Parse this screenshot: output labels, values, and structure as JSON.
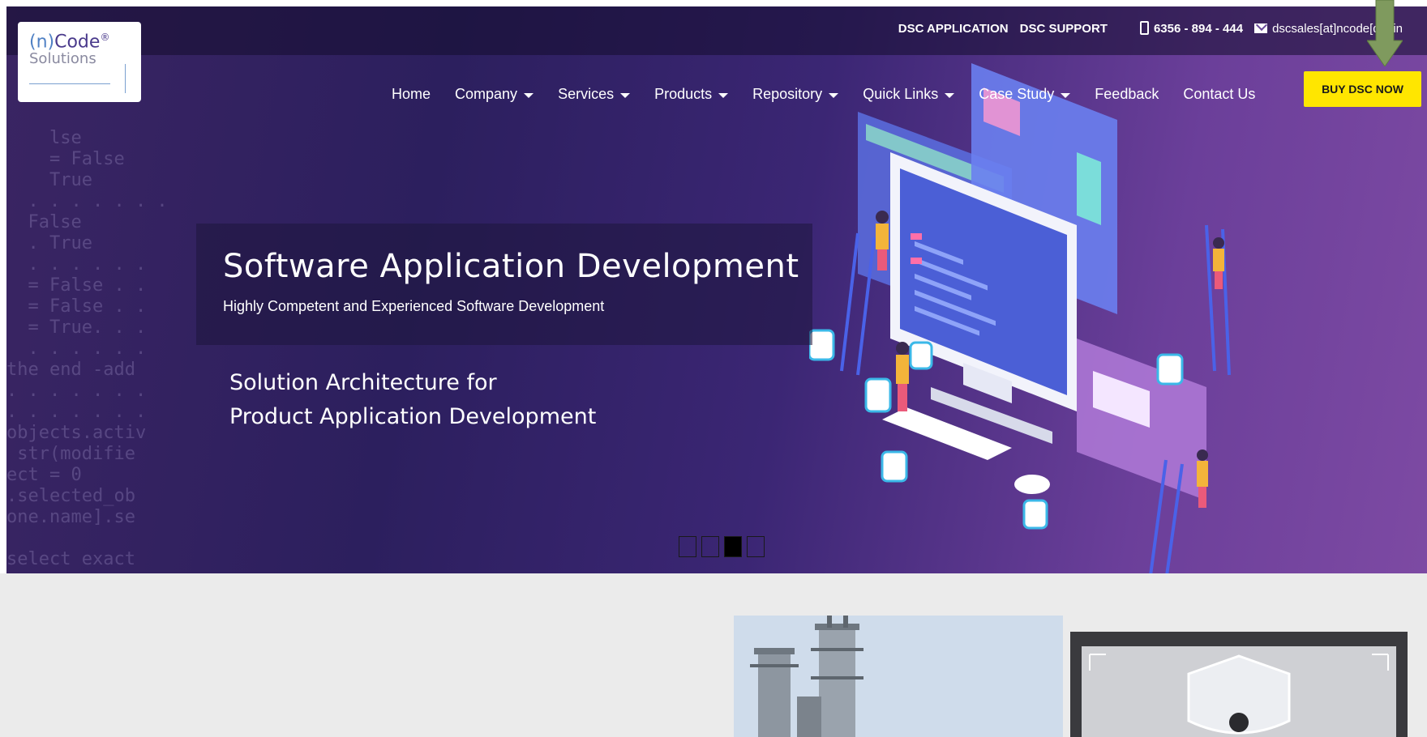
{
  "logo": {
    "brand_paren": "(n)",
    "brand_word": "Code",
    "brand_mark": "®",
    "sub": "Solutions"
  },
  "topbar": {
    "dsc_application": "DSC APPLICATION",
    "dsc_support": "DSC SUPPORT",
    "phone": "6356 - 894 - 444",
    "email": "dscsales[at]ncode[dot]in"
  },
  "nav": {
    "items": [
      {
        "label": "Home",
        "dropdown": false
      },
      {
        "label": "Company",
        "dropdown": true
      },
      {
        "label": "Services",
        "dropdown": true
      },
      {
        "label": "Products",
        "dropdown": true
      },
      {
        "label": "Repository",
        "dropdown": true
      },
      {
        "label": "Quick Links",
        "dropdown": true
      },
      {
        "label": "Case Study",
        "dropdown": true
      },
      {
        "label": "Feedback",
        "dropdown": false
      },
      {
        "label": "Contact Us",
        "dropdown": false
      }
    ],
    "buy_button": "BUY DSC NOW"
  },
  "hero": {
    "title": "Software Application Development",
    "subtitle": "Highly Competent and Experienced Software Development",
    "line1": "Solution Architecture for",
    "line2": "Product Application Development",
    "slides_total": 4,
    "active_slide": 3
  },
  "code_bg_text": "    lse\n    = False\n    True\n  . . . . . . .\n  False\n  . True\n  . . . . . .\n  = False . .\n  = False . .\n  = True. . .\n  . . . . . .\nthe end -add\n. . . . . . .\n. . . . . . .\nobjects.activ\n str(modifie\nect = 0\n.selected_ob\none.name].se\n\nselect exact",
  "colors": {
    "buy_button_bg": "#ffe600",
    "hero_gradient_start": "#3a2563",
    "hero_gradient_end": "#7d4aa3",
    "lower_background": "#ebebeb"
  }
}
